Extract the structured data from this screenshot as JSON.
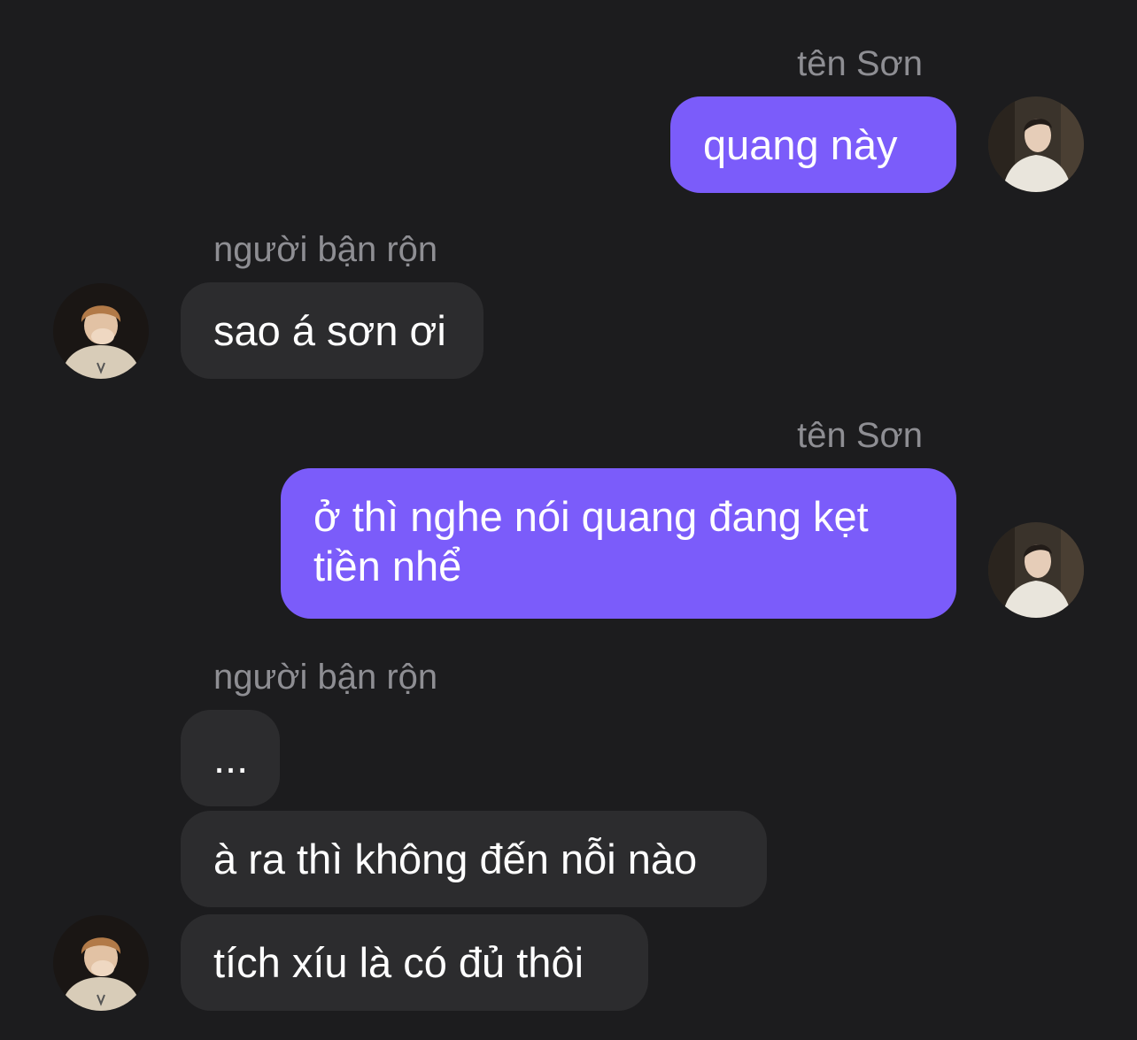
{
  "messages": [
    {
      "sender": "tên Sơn",
      "direction": "outgoing",
      "bubbles": [
        "quang này"
      ]
    },
    {
      "sender": "người bận rộn",
      "direction": "incoming",
      "bubbles": [
        "sao á sơn ơi"
      ]
    },
    {
      "sender": "tên Sơn",
      "direction": "outgoing",
      "bubbles": [
        "ở thì nghe nói quang đang kẹt tiền nhể"
      ]
    },
    {
      "sender": "người bận rộn",
      "direction": "incoming",
      "bubbles": [
        "...",
        "à ra thì không đến nỗi nào",
        "tích xíu là có đủ thôi"
      ]
    }
  ],
  "avatars": {
    "outgoing": "avatar-photo-man-white-shirt",
    "incoming": "avatar-photo-person-covering-face"
  },
  "colors": {
    "background": "#1c1c1e",
    "outgoing_bubble": "#7b5cfa",
    "incoming_bubble": "#2c2c2e",
    "sender_text": "#8e8e93",
    "message_text": "#ffffff"
  }
}
